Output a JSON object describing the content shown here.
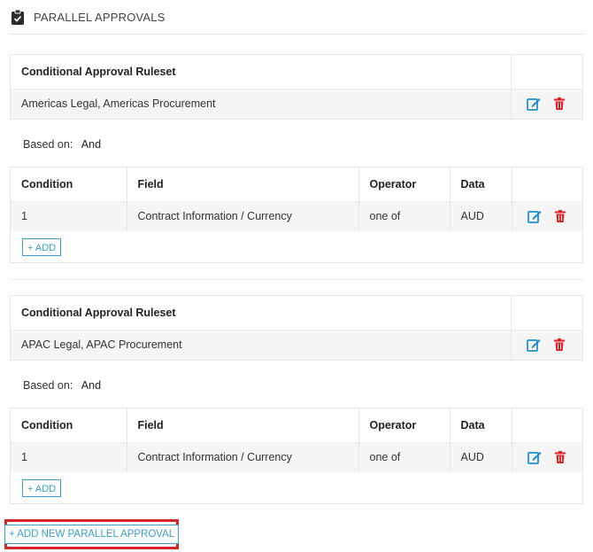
{
  "header": {
    "title": "PARALLEL APPROVALS",
    "icon": "clipboard-check-icon"
  },
  "colors": {
    "accent": "#3aa0c9",
    "edit": "#1f8fd1",
    "delete": "#e0242b",
    "highlight": "#d8232a"
  },
  "rulesets": [
    {
      "ruleset_header": "Conditional Approval Ruleset",
      "ruleset_value": "Americas Legal, Americas Procurement",
      "based_on_label": "Based on:",
      "based_on_value": "And",
      "columns": [
        "Condition",
        "Field",
        "Operator",
        "Data"
      ],
      "rows": [
        {
          "condition": "1",
          "field": "Contract Information / Currency",
          "operator": "one of",
          "data": "AUD"
        }
      ],
      "add_label": "+ ADD"
    },
    {
      "ruleset_header": "Conditional Approval Ruleset",
      "ruleset_value": "APAC Legal, APAC Procurement",
      "based_on_label": "Based on:",
      "based_on_value": "And",
      "columns": [
        "Condition",
        "Field",
        "Operator",
        "Data"
      ],
      "rows": [
        {
          "condition": "1",
          "field": "Contract Information / Currency",
          "operator": "one of",
          "data": "AUD"
        }
      ],
      "add_label": "+ ADD"
    }
  ],
  "add_new_label": "+ ADD NEW PARALLEL APPROVAL"
}
